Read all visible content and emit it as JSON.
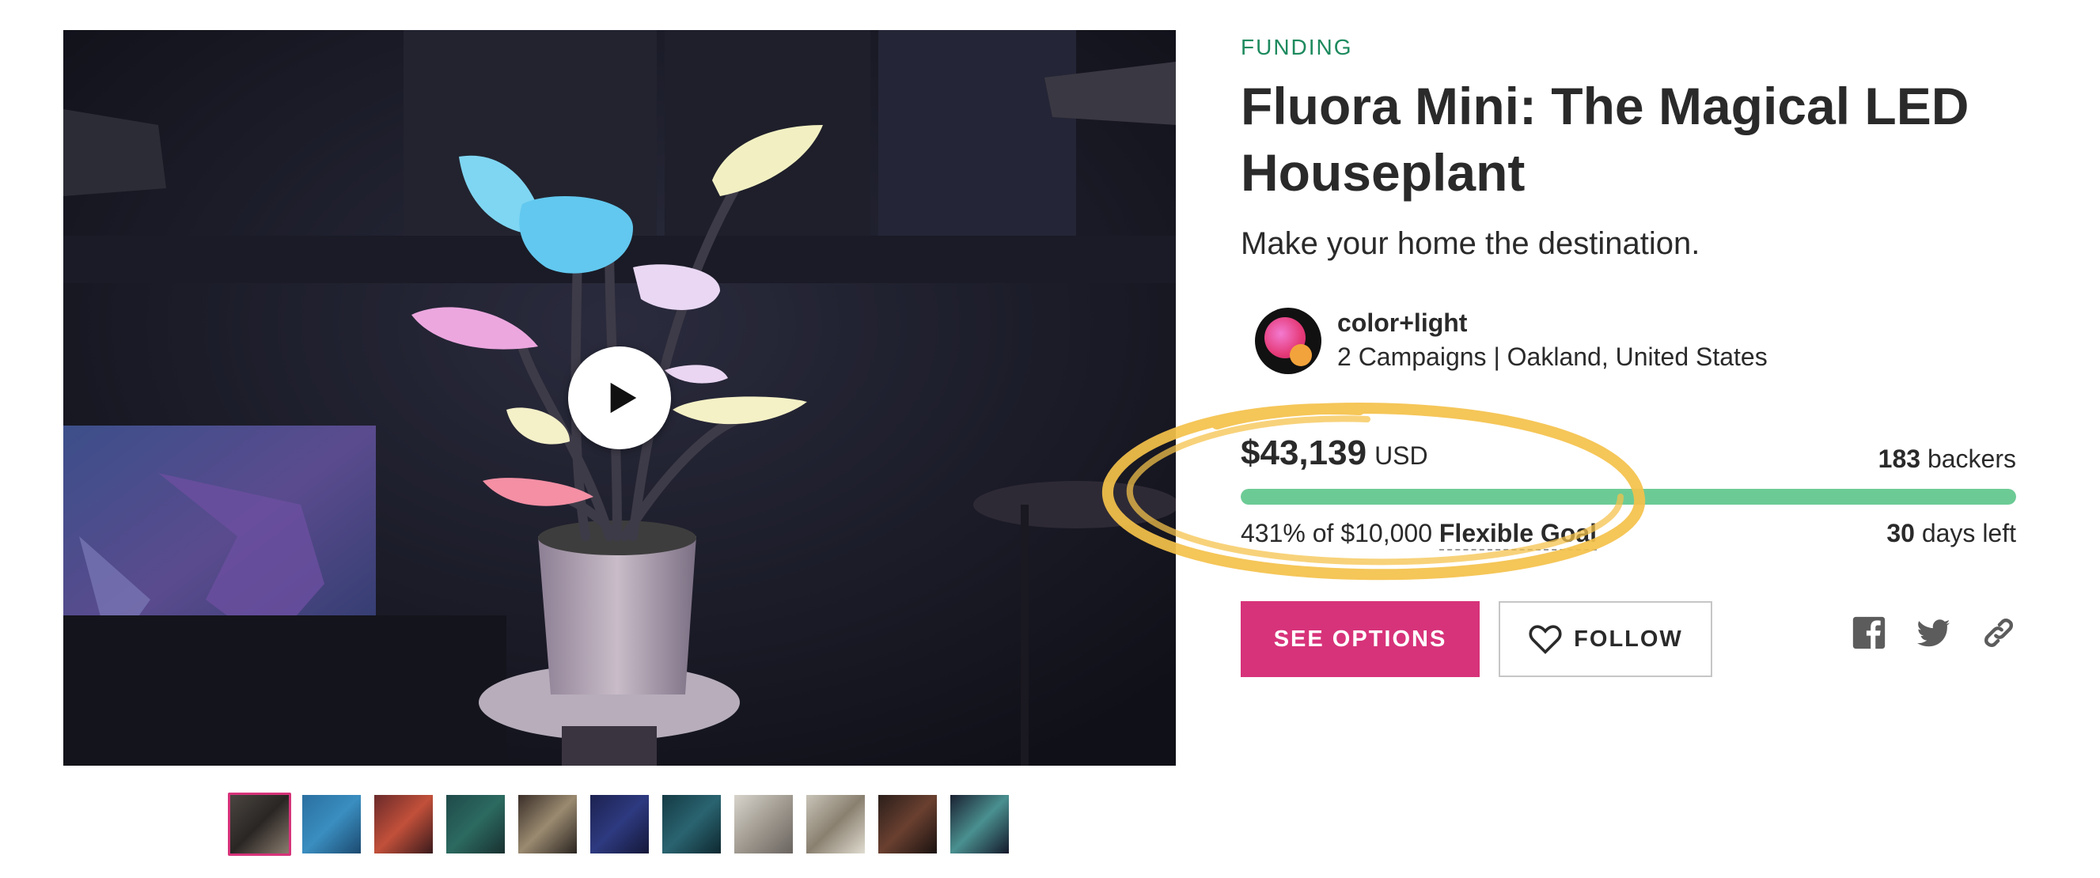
{
  "campaign": {
    "status_label": "FUNDING",
    "title": "Fluora Mini: The Magical LED Houseplant",
    "tagline": "Make your home the destination."
  },
  "owner": {
    "name": "color+light",
    "meta": "2 Campaigns | Oakland, United States"
  },
  "funding": {
    "raised_amount": "$43,139",
    "currency": "USD",
    "backers_count": "183",
    "backers_label": "backers",
    "progress_percent": 100,
    "percent_text": "431% of $10,000",
    "goal_type": "Flexible Goal",
    "days_count": "30",
    "days_label": "days left"
  },
  "actions": {
    "see_options_label": "SEE OPTIONS",
    "follow_label": "FOLLOW"
  },
  "social": {
    "icons": [
      "facebook-icon",
      "twitter-icon",
      "link-icon"
    ]
  },
  "gallery": {
    "thumbnail_count": 11,
    "active_index": 0
  },
  "colors": {
    "accent_pink": "#d7337a",
    "funding_green": "#1d8a5e",
    "progress_green": "#6ccb95",
    "highlight_yellow": "#f5c24a"
  }
}
